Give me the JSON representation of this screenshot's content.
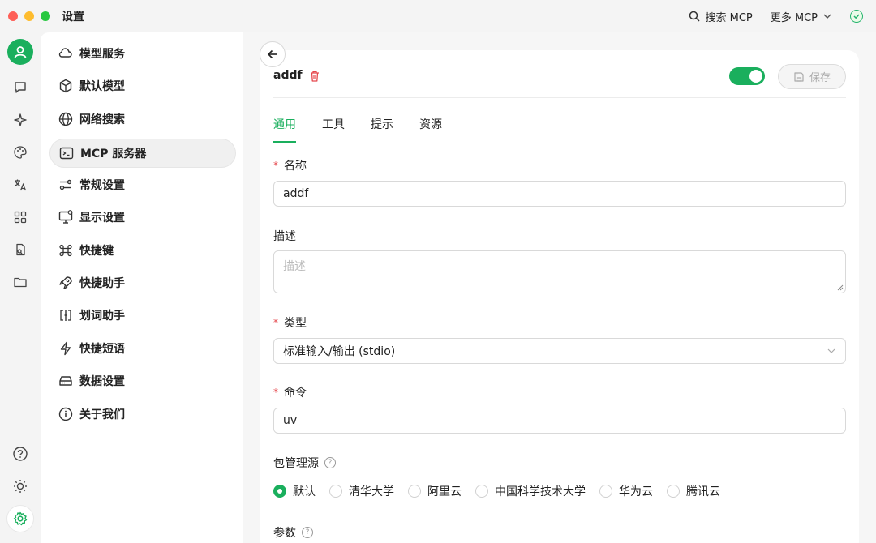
{
  "window": {
    "title": "设置"
  },
  "titlebar": {
    "search_mcp": "搜索 MCP",
    "more_mcp": "更多 MCP"
  },
  "rail": {
    "items": [
      "chat-icon",
      "sparkle-icon",
      "palette-icon",
      "translate-icon",
      "apps-icon",
      "files-icon",
      "folder-icon"
    ],
    "bottom": [
      "help-icon",
      "theme-icon",
      "settings-icon"
    ]
  },
  "menu": {
    "items": [
      {
        "label": "模型服务",
        "icon": "cloud-icon"
      },
      {
        "label": "默认模型",
        "icon": "cube-icon"
      },
      {
        "label": "网络搜索",
        "icon": "globe-icon"
      },
      {
        "label": "MCP 服务器",
        "icon": "terminal-icon",
        "active": true
      },
      {
        "label": "常规设置",
        "icon": "sliders-icon"
      },
      {
        "label": "显示设置",
        "icon": "monitor-icon"
      },
      {
        "label": "快捷键",
        "icon": "command-icon"
      },
      {
        "label": "快捷助手",
        "icon": "rocket-icon"
      },
      {
        "label": "划词助手",
        "icon": "text-select-icon"
      },
      {
        "label": "快捷短语",
        "icon": "zap-icon"
      },
      {
        "label": "数据设置",
        "icon": "storage-icon"
      },
      {
        "label": "关于我们",
        "icon": "info-icon"
      }
    ]
  },
  "server": {
    "name": "addf",
    "enabled": true,
    "save_label": "保存"
  },
  "tabs": [
    "通用",
    "工具",
    "提示",
    "资源"
  ],
  "form": {
    "name_label": "名称",
    "name_value": "addf",
    "desc_label": "描述",
    "desc_placeholder": "描述",
    "type_label": "类型",
    "type_value": "标准输入/输出 (stdio)",
    "command_label": "命令",
    "command_value": "uv",
    "registry_label": "包管理源",
    "registry_options": [
      "默认",
      "清华大学",
      "阿里云",
      "中国科学技术大学",
      "华为云",
      "腾讯云"
    ],
    "registry_selected": "默认",
    "args_label": "参数"
  },
  "colors": {
    "accent": "#1aaf5d",
    "danger": "#e5484d"
  }
}
